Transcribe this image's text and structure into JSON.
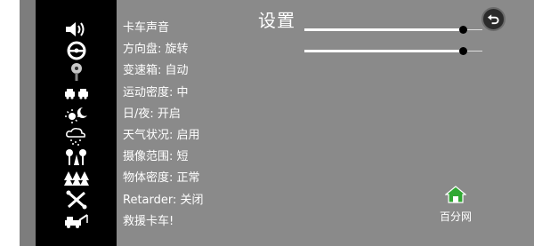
{
  "title": "设置",
  "menu": {
    "items": [
      {
        "label": "卡车声音",
        "icon": "speaker-icon"
      },
      {
        "label": "方向盘: 旋转",
        "icon": "steering-wheel-icon"
      },
      {
        "label": "变速箱: 自动",
        "icon": "gear-shift-icon"
      },
      {
        "label": "运动密度: 中",
        "icon": "traffic-cars-icon"
      },
      {
        "label": "日/夜: 开启",
        "icon": "day-night-icon"
      },
      {
        "label": "天气状况: 启用",
        "icon": "weather-icon"
      },
      {
        "label": "摄像范围: 短",
        "icon": "camera-range-icon"
      },
      {
        "label": "物体密度: 正常",
        "icon": "trees-icon"
      },
      {
        "label": "Retarder: 关闭",
        "icon": "retarder-icon"
      },
      {
        "label": "救援卡车!",
        "icon": "tow-truck-icon"
      }
    ]
  },
  "sliders": [
    {
      "name": "truck-sound-volume",
      "value": 0.89
    },
    {
      "name": "steering-sensitivity",
      "value": 0.89
    }
  ],
  "logo": {
    "text": "百分网"
  },
  "colors": {
    "accent_green": "#2fa832",
    "background": "#8a8a8a",
    "sidebar": "#000000"
  }
}
